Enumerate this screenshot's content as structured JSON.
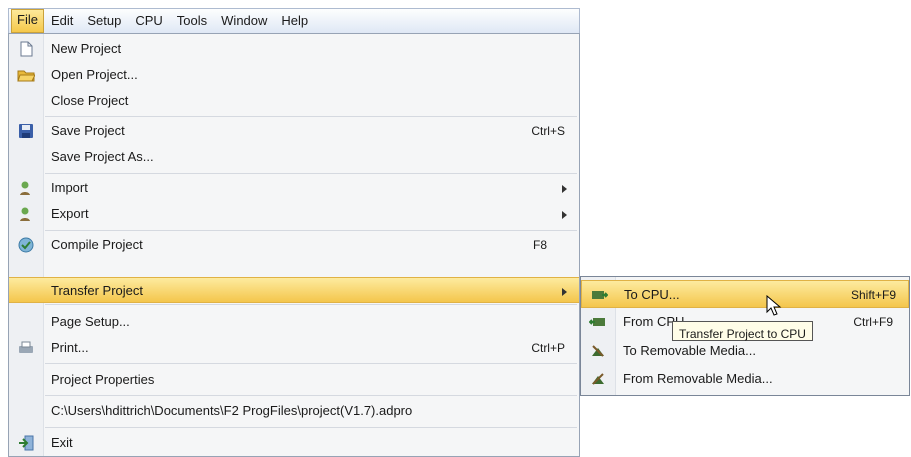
{
  "menubar": {
    "items": [
      "File",
      "Edit",
      "Setup",
      "CPU",
      "Tools",
      "Window",
      "Help"
    ],
    "active": "File"
  },
  "file_menu": {
    "items": [
      {
        "label": "New Project",
        "icon": "new-document-icon"
      },
      {
        "label": "Open Project...",
        "icon": "open-folder-icon"
      },
      {
        "label": "Close Project"
      },
      {
        "label": "Save Project",
        "shortcut": "Ctrl+S",
        "icon": "save-disk-icon"
      },
      {
        "label": "Save Project As..."
      },
      {
        "label": "Import",
        "icon": "import-icon",
        "submenu": true
      },
      {
        "label": "Export",
        "icon": "export-icon",
        "submenu": true
      },
      {
        "label": "Compile Project",
        "shortcut": "F8",
        "icon": "compile-icon"
      },
      {
        "label": "Transfer Project",
        "submenu": true,
        "highlighted": true
      },
      {
        "label": "Page Setup..."
      },
      {
        "label": "Print...",
        "shortcut": "Ctrl+P",
        "icon": "printer-icon"
      },
      {
        "label": "Project Properties"
      },
      {
        "label": "C:\\Users\\hdittrich\\Documents\\F2 ProgFiles\\project(V1.7).adpro"
      },
      {
        "label": "Exit",
        "icon": "exit-icon"
      }
    ]
  },
  "transfer_submenu": {
    "items": [
      {
        "label": "To CPU...",
        "shortcut": "Shift+F9",
        "icon": "to-cpu-icon",
        "highlighted": true
      },
      {
        "label": "From CPU...",
        "shortcut": "Ctrl+F9",
        "icon": "from-cpu-icon"
      },
      {
        "label": "To Removable Media...",
        "icon": "to-media-icon"
      },
      {
        "label": "From Removable Media...",
        "icon": "from-media-icon"
      }
    ]
  },
  "tooltip": "Transfer Project to CPU",
  "colors": {
    "highlight": "#f4c64c",
    "menu_bg": "#f5f6f7",
    "border": "#97a3b5"
  }
}
